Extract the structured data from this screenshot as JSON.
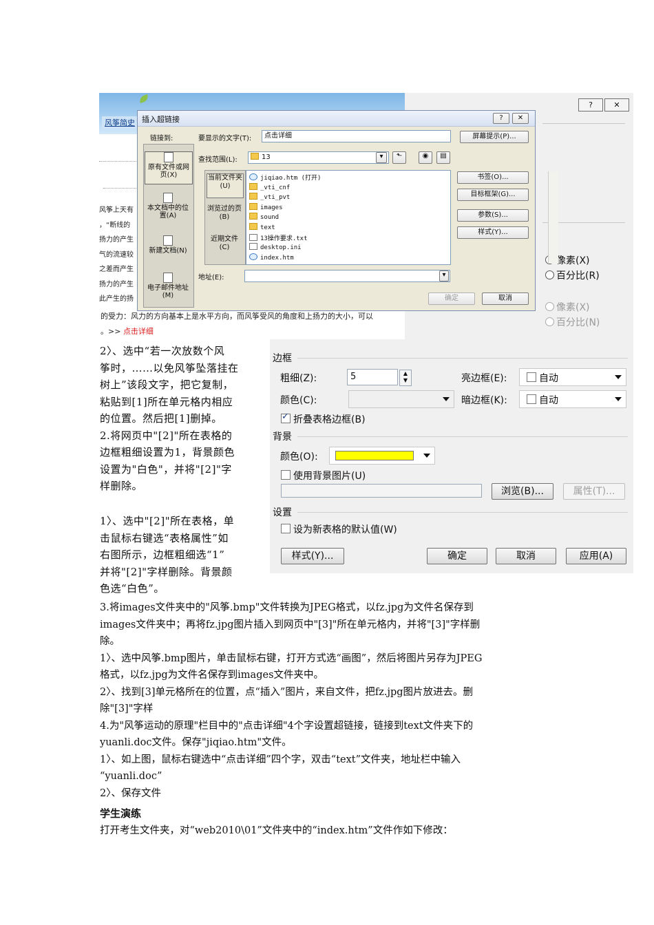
{
  "webpage": {
    "nav_tab": "风筝简史",
    "side_lines": [
      "风筝上天有",
      "，“断线的",
      "扬力的产生",
      "气的流速较",
      "之差而产生",
      "扬力的产生",
      "此产生的扬"
    ],
    "last_line": "的受力：风力的方向基本上是水平方向，而风筝受风的角度和上扬力的大小，可以",
    "more_prefix": "。>> ",
    "more_link": "点击详细"
  },
  "hyperlink_dialog": {
    "title": "插入超链接",
    "help_btn": "?",
    "close_btn": "✕",
    "link_to_label": "链接到:",
    "display_text_label": "要显示的文字(T):",
    "display_text_value": "点击详细",
    "screen_tip_btn": "屏幕提示(P)...",
    "look_in_label": "查找范围(L):",
    "look_in_value": "13",
    "sidebar": [
      "原有文件或网页(X)",
      "本文档中的位置(A)",
      "新建文档(N)",
      "电子邮件地址(M)"
    ],
    "sub_sidebar": [
      "当前文件夹(U)",
      "浏览过的页(B)",
      "近期文件(C)"
    ],
    "files": [
      {
        "name": "jiqiao.htm (打开)",
        "kind": "ie"
      },
      {
        "name": "_vti_cnf",
        "kind": "folder"
      },
      {
        "name": "_vti_pvt",
        "kind": "folder"
      },
      {
        "name": "images",
        "kind": "folder"
      },
      {
        "name": "sound",
        "kind": "folder"
      },
      {
        "name": "text",
        "kind": "folder"
      },
      {
        "name": "13操作要求.txt",
        "kind": "doc"
      },
      {
        "name": "desktop.ini",
        "kind": "doc"
      },
      {
        "name": "index.htm",
        "kind": "ie"
      }
    ],
    "right_buttons": [
      "书签(O)...",
      "目标框架(G)...",
      "参数(S)...",
      "样式(Y)..."
    ],
    "address_label": "地址(E):",
    "ok_btn": "确定",
    "cancel_btn": "取消"
  },
  "table_props": {
    "help_btn": "?",
    "close_btn": "✕",
    "radio_pixels_1": "像素(X)",
    "radio_percent_1": "百分比(R)",
    "radio_pixels_2": "像素(X)",
    "radio_percent_2": "百分比(N)",
    "border_section": "边框",
    "thickness_label": "粗细(Z):",
    "thickness_value": "5",
    "light_border_label": "亮边框(E):",
    "light_border_value": "自动",
    "color_label": "颜色(C):",
    "dark_border_label": "暗边框(K):",
    "dark_border_value": "自动",
    "collapse_label": "折叠表格边框(B)",
    "background_section": "背景",
    "bg_color_label": "颜色(O):",
    "bg_color_value": "#ffff00",
    "use_bg_image_label": "使用背景图片(U)",
    "browse_btn": "浏览(B)...",
    "props_btn": "属性(T)...",
    "settings_section": "设置",
    "default_label": "设为新表格的默认值(W)",
    "style_btn": "样式(Y)...",
    "ok_btn": "确定",
    "cancel_btn": "取消",
    "apply_btn": "应用(A)"
  },
  "doc": {
    "narrow_lines": [
      "2〉、选中“若一次放数个风",
      "筝时，……以免风筝坠落挂在",
      "树上”该段文字，把它复制，",
      "粘贴到[1]所在单元格内相应",
      "的位置。然后把[1]删掉。",
      "2.将网页中\"[2]\"所在表格的",
      "边框粗细设置为1，背景颜色",
      "设置为\"白色\"，并将\"[2]\"字",
      "样删除。"
    ],
    "narrow2_lines": [
      "1〉、选中\"[2]\"所在表格，单",
      "击鼠标右键选“表格属性”如",
      "右图所示，边框粗细选“1”",
      "并将\"[2]\"字样删除。背景颜",
      "色选“白色”。"
    ],
    "full_lines": [
      " 3.将images文件夹中的\"风筝.bmp\"文件转换为JPEG格式，以fz.jpg为文件名保存到",
      "images文件夹中；再将fz.jpg图片插入到网页中\"[3]\"所在单元格内，并将\"[3]\"字样删",
      "除。",
      "1〉、选中风筝.bmp图片，单击鼠标右键，打开方式选“画图”，然后将图片另存为JPEG",
      "格式，以fz.jpg为文件名保存到images文件夹中。",
      "2〉、找到[3]单元格所在的位置，点“插入”图片，来自文件，把fz.jpg图片放进去。删",
      "除\"[3]\"字样",
      "4.为\"风筝运动的原理\"栏目中的\"点击详细\"4个字设置超链接，链接到text文件夹下的",
      "yuanli.doc文件。保存\"jiqiao.htm\"文件。",
      "1〉、如上图，鼠标右键选中“点击详细”四个字，双击“text”文件夹，地址栏中输入",
      "“yuanli.doc”",
      "2〉、保存文件"
    ],
    "heading": "学生演练",
    "final_line": "打开考生文件夹，对“web2010\\01”文件夹中的“index.htm”文件作如下修改："
  }
}
